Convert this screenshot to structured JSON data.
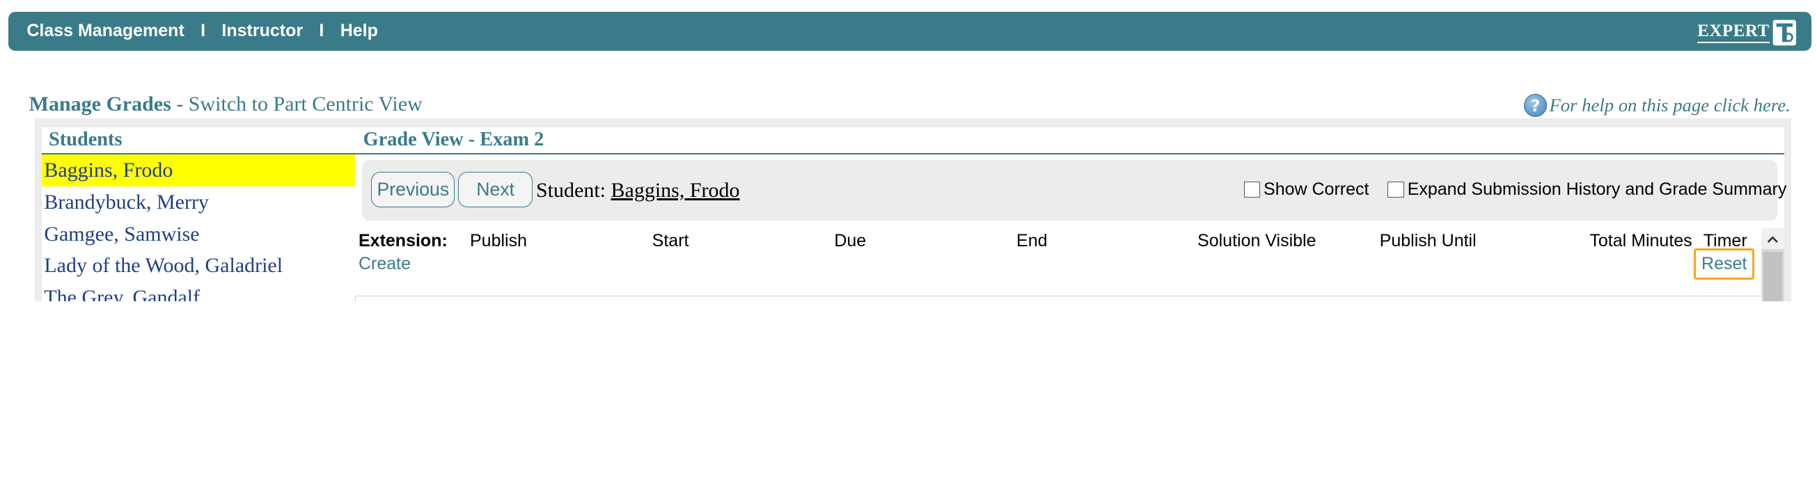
{
  "nav": {
    "items": [
      "Class Management",
      "Instructor",
      "Help"
    ],
    "separator": "I",
    "logo_text": "EXPERT",
    "logo_icon": "expert-ta-logo"
  },
  "heading": {
    "title": "Manage Grades",
    "dash": " - ",
    "switch_link": "Switch to Part Centric View",
    "help_text": "For help on this page click here.",
    "help_icon": "question-circle-icon"
  },
  "students": {
    "header": "Students",
    "list": [
      "Baggins, Frodo",
      "Brandybuck, Merry",
      "Gamgee, Samwise",
      "Lady of the Wood, Galadriel",
      "The Grey, Gandalf"
    ],
    "selected": "Baggins, Frodo"
  },
  "grade_view": {
    "header": "Grade View - Exam 2",
    "previous_label": "Previous",
    "next_label": "Next",
    "student_label": "Student:",
    "student_name": "Baggins, Frodo",
    "show_correct_label": "Show Correct",
    "expand_label": "Expand Submission History and Grade Summary"
  },
  "table": {
    "extension_label": "Extension:",
    "columns": [
      "Publish",
      "Start",
      "Due",
      "End",
      "Solution Visible",
      "Publish Until",
      "Total Minutes",
      "Timer"
    ],
    "create_label": "Create",
    "reset_label": "Reset"
  },
  "colors": {
    "brand": "#3a7b89",
    "selection": "#ffff00",
    "focus": "#f4a81c",
    "link": "#1e3f8a"
  }
}
